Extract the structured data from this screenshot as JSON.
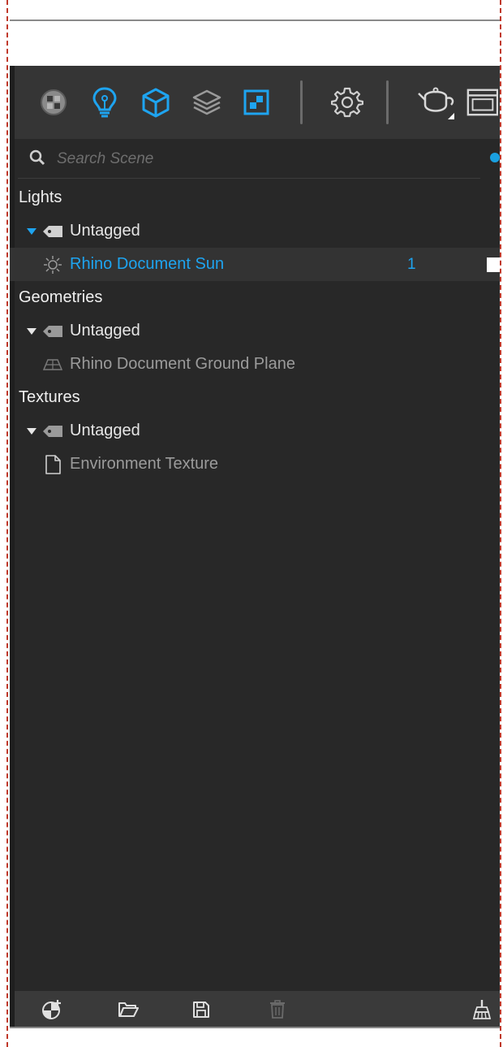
{
  "toolbar": {
    "icons": [
      "materials-icon",
      "lights-icon",
      "geometries-icon",
      "layers-icon",
      "textures-icon",
      "settings-icon",
      "teapot-icon",
      "window-icon"
    ]
  },
  "search": {
    "placeholder": "Search Scene",
    "value": ""
  },
  "tree": {
    "lights": {
      "label": "Lights",
      "tag_label": "Untagged",
      "item": {
        "label": "Rhino Document Sun",
        "count": "1"
      }
    },
    "geometries": {
      "label": "Geometries",
      "tag_label": "Untagged",
      "item": {
        "label": "Rhino Document Ground Plane"
      }
    },
    "textures": {
      "label": "Textures",
      "tag_label": "Untagged",
      "item": {
        "label": "Environment Texture"
      }
    }
  },
  "bottombar": {
    "icons": [
      "add-material-icon",
      "open-folder-icon",
      "save-icon",
      "delete-icon",
      "clean-broom-icon"
    ]
  },
  "colors": {
    "accent": "#1ea4f0",
    "panel": "#282828",
    "toolbar": "#353535",
    "text": "#e6e6e6",
    "muted": "#9b9b9b"
  }
}
